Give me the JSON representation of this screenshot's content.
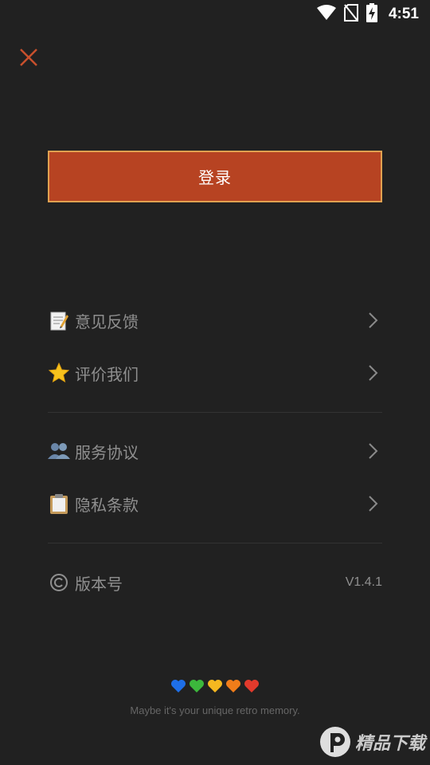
{
  "status_bar": {
    "time": "4:51"
  },
  "login_button": {
    "label": "登录"
  },
  "menu": {
    "group1": [
      {
        "icon": "memo-icon",
        "label": "意见反馈"
      },
      {
        "icon": "star-icon",
        "label": "评价我们"
      }
    ],
    "group2": [
      {
        "icon": "people-icon",
        "label": "服务协议"
      },
      {
        "icon": "clipboard-icon",
        "label": "隐私条款"
      }
    ],
    "version": {
      "icon": "copyright-icon",
      "label": "版本号",
      "value": "V1.4.1"
    }
  },
  "footer": {
    "hearts": [
      "#1e6fe8",
      "#3cb83c",
      "#f5b820",
      "#f07d1a",
      "#e23a2c"
    ],
    "tagline": "Maybe it's your unique retro memory."
  },
  "watermark": {
    "text": "精品下载"
  },
  "colors": {
    "background": "#212121",
    "accent": "#b74322",
    "accent_border": "#e0a150",
    "close": "#c8502c"
  }
}
